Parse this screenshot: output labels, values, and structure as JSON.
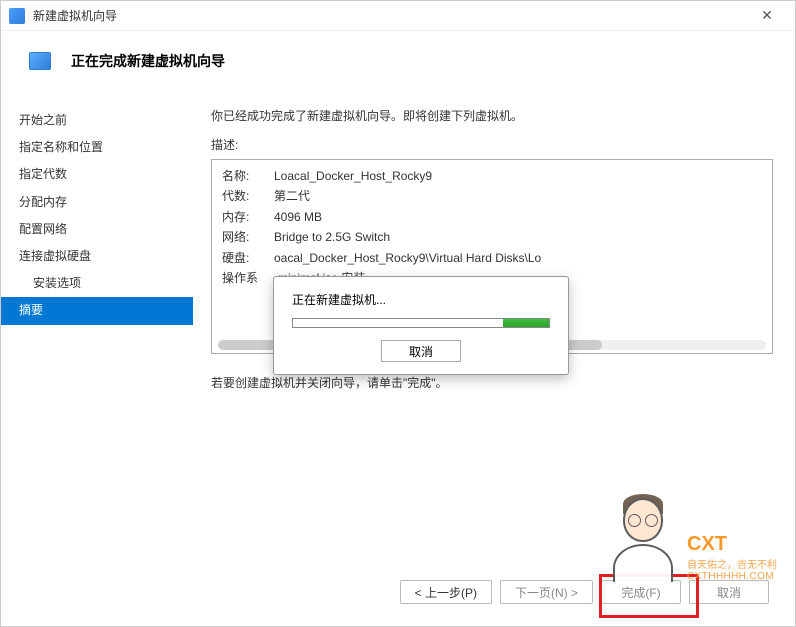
{
  "titlebar": {
    "title": "新建虚拟机向导",
    "close": "✕"
  },
  "header": {
    "title": "正在完成新建虚拟机向导"
  },
  "sidebar": {
    "items": [
      {
        "label": "开始之前",
        "indent": false
      },
      {
        "label": "指定名称和位置",
        "indent": false
      },
      {
        "label": "指定代数",
        "indent": false
      },
      {
        "label": "分配内存",
        "indent": false
      },
      {
        "label": "配置网络",
        "indent": false
      },
      {
        "label": "连接虚拟硬盘",
        "indent": false
      },
      {
        "label": "安装选项",
        "indent": true
      },
      {
        "label": "摘要",
        "indent": false,
        "active": true
      }
    ]
  },
  "content": {
    "intro": "你已经成功完成了新建虚拟机向导。即将创建下列虚拟机。",
    "desc_label": "描述:",
    "rows": [
      {
        "key": "名称:",
        "val": "Loacal_Docker_Host_Rocky9"
      },
      {
        "key": "代数:",
        "val": "第二代"
      },
      {
        "key": "内存:",
        "val": "4096 MB"
      },
      {
        "key": "网络:",
        "val": "Bridge to 2.5G Switch"
      },
      {
        "key": "硬盘:",
        "val": "                                                          oacal_Docker_Host_Rocky9\\Virtual Hard Disks\\Lo"
      },
      {
        "key": "操作系",
        "val": "                                                          -minimal.iso 安装"
      }
    ],
    "footer": "若要创建虚拟机并关闭向导，请单击\"完成\"。"
  },
  "progress": {
    "title": "正在新建虚拟机...",
    "cancel": "取消"
  },
  "buttons": {
    "prev": "< 上一步(P)",
    "next": "下一页(N) >",
    "finish": "完成(F)",
    "cancel": "取消"
  },
  "watermark": {
    "brand": "CXT",
    "sub": "自天佑之，吉无不利",
    "url": "CXTHHHHH.COM"
  }
}
